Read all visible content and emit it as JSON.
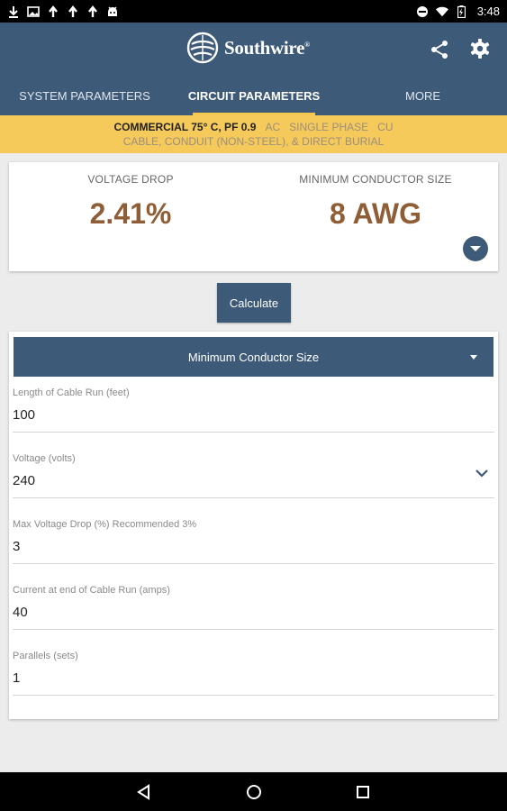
{
  "status_bar": {
    "time": "3:48",
    "left_icons": [
      "download-icon",
      "image-icon",
      "upload-icon",
      "upload-icon",
      "upload-icon",
      "android-icon"
    ],
    "right_icons": [
      "do-not-disturb-icon",
      "wifi-icon",
      "battery-icon"
    ]
  },
  "app_bar": {
    "logo_text": "Southwire",
    "logo_mark": "®",
    "share_icon": "share-icon",
    "settings_icon": "gear-icon"
  },
  "tabs": [
    {
      "label": "SYSTEM PARAMETERS",
      "active": false
    },
    {
      "label": "CIRCUIT PARAMETERS",
      "active": true
    },
    {
      "label": "MORE",
      "active": false
    }
  ],
  "banner": {
    "bold_text": "COMMERCIAL 75° C, PF 0.9",
    "current_type": "AC",
    "phase": "SINGLE PHASE",
    "conductor": "CU",
    "installation": "CABLE, CONDUIT (NON-STEEL), & DIRECT BURIAL"
  },
  "results": {
    "voltage_drop_label": "VOLTAGE DROP",
    "voltage_drop_value": "2.41%",
    "min_size_label": "MINIMUM CONDUCTOR SIZE",
    "min_size_value": "8 AWG",
    "expand_icon": "chevron-down-icon"
  },
  "calculate_label": "Calculate",
  "mode_select": {
    "value": "Minimum Conductor Size"
  },
  "fields": [
    {
      "label": "Length of Cable Run (feet)",
      "value": "100"
    },
    {
      "label": "Voltage (volts)",
      "value": "240"
    },
    {
      "label": "Max Voltage Drop (%) Recommended 3%",
      "value": "3"
    },
    {
      "label": "Current at end of Cable Run (amps)",
      "value": "40"
    },
    {
      "label": "Parallels (sets)",
      "value": "1"
    }
  ],
  "colors": {
    "primary": "#3d5a78",
    "accent": "#f6c95b",
    "result": "#8f5e36"
  }
}
